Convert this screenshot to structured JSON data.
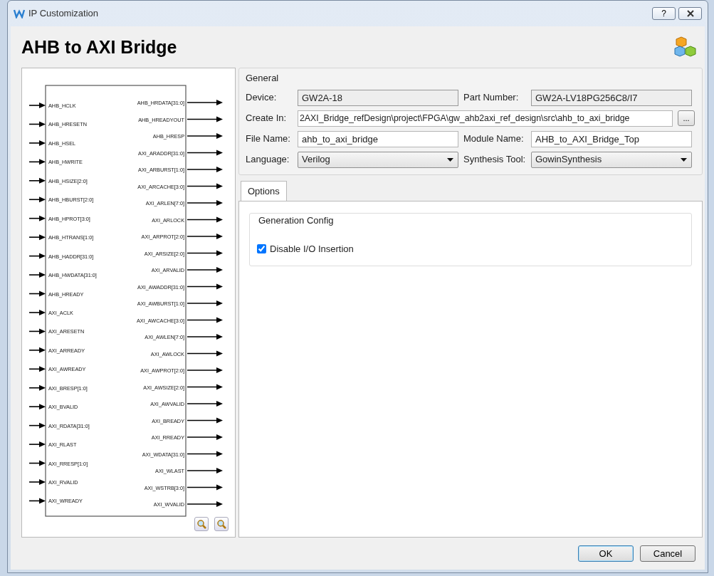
{
  "window": {
    "title": "IP Customization",
    "help_button": "?"
  },
  "header": {
    "title": "AHB to AXI Bridge"
  },
  "diagram": {
    "inputs": [
      "AHB_HCLK",
      "AHB_HRESETN",
      "AHB_HSEL",
      "AHB_HWRITE",
      "AHB_HSIZE[2:0]",
      "AHB_HBURST[2:0]",
      "AHB_HPROT[3:0]",
      "AHB_HTRANS[1:0]",
      "AHB_HADDR[31:0]",
      "AHB_HWDATA[31:0]",
      "AHB_HREADY",
      "AXI_ACLK",
      "AXI_ARESETN",
      "AXI_ARREADY",
      "AXI_AWREADY",
      "AXI_BRESP[1:0]",
      "AXI_BVALID",
      "AXI_RDATA[31:0]",
      "AXI_RLAST",
      "AXI_RRESP[1:0]",
      "AXI_RVALID",
      "AXI_WREADY"
    ],
    "outputs": [
      "AHB_HRDATA[31:0]",
      "AHB_HREADYOUT",
      "AHB_HRESP",
      "AXI_ARADDR[31:0]",
      "AXI_ARBURST[1:0]",
      "AXI_ARCACHE[3:0]",
      "AXI_ARLEN[7:0]",
      "AXI_ARLOCK",
      "AXI_ARPROT[2:0]",
      "AXI_ARSIZE[2:0]",
      "AXI_ARVALID",
      "AXI_AWADDR[31:0]",
      "AXI_AWBURST[1:0]",
      "AXI_AWCACHE[3:0]",
      "AXI_AWLEN[7:0]",
      "AXI_AWLOCK",
      "AXI_AWPROT[2:0]",
      "AXI_AWSIZE[2:0]",
      "AXI_AWVALID",
      "AXI_BREADY",
      "AXI_RREADY",
      "AXI_WDATA[31:0]",
      "AXI_WLAST",
      "AXI_WSTRB[3:0]",
      "AXI_WVALID"
    ]
  },
  "general": {
    "title": "General",
    "rows": [
      [
        {
          "label": "Device:",
          "value": "GW2A-18",
          "kind": "readonly"
        },
        {
          "label": "Part Number:",
          "value": "GW2A-LV18PG256C8/I7",
          "kind": "readonly"
        }
      ],
      [
        {
          "label": "Create In:",
          "value": "2AXI_Bridge_refDesign\\project\\FPGA\\gw_ahb2axi_ref_design\\src\\ahb_to_axi_bridge",
          "kind": "path",
          "browse": "..."
        }
      ],
      [
        {
          "label": "File Name:",
          "value": "ahb_to_axi_bridge",
          "kind": "text"
        },
        {
          "label": "Module Name:",
          "value": "AHB_to_AXI_Bridge_Top",
          "kind": "text"
        }
      ],
      [
        {
          "label": "Language:",
          "value": "Verilog",
          "kind": "select"
        },
        {
          "label": "Synthesis Tool:",
          "value": "GowinSynthesis",
          "kind": "select"
        }
      ]
    ]
  },
  "tabs": [
    {
      "label": "Options",
      "selected": true
    }
  ],
  "generation_config": {
    "title": "Generation Config",
    "options": [
      {
        "label": "Disable I/O Insertion",
        "checked": true
      }
    ]
  },
  "footer_buttons": [
    {
      "label": "OK",
      "default": true
    },
    {
      "label": "Cancel",
      "default": false
    }
  ]
}
